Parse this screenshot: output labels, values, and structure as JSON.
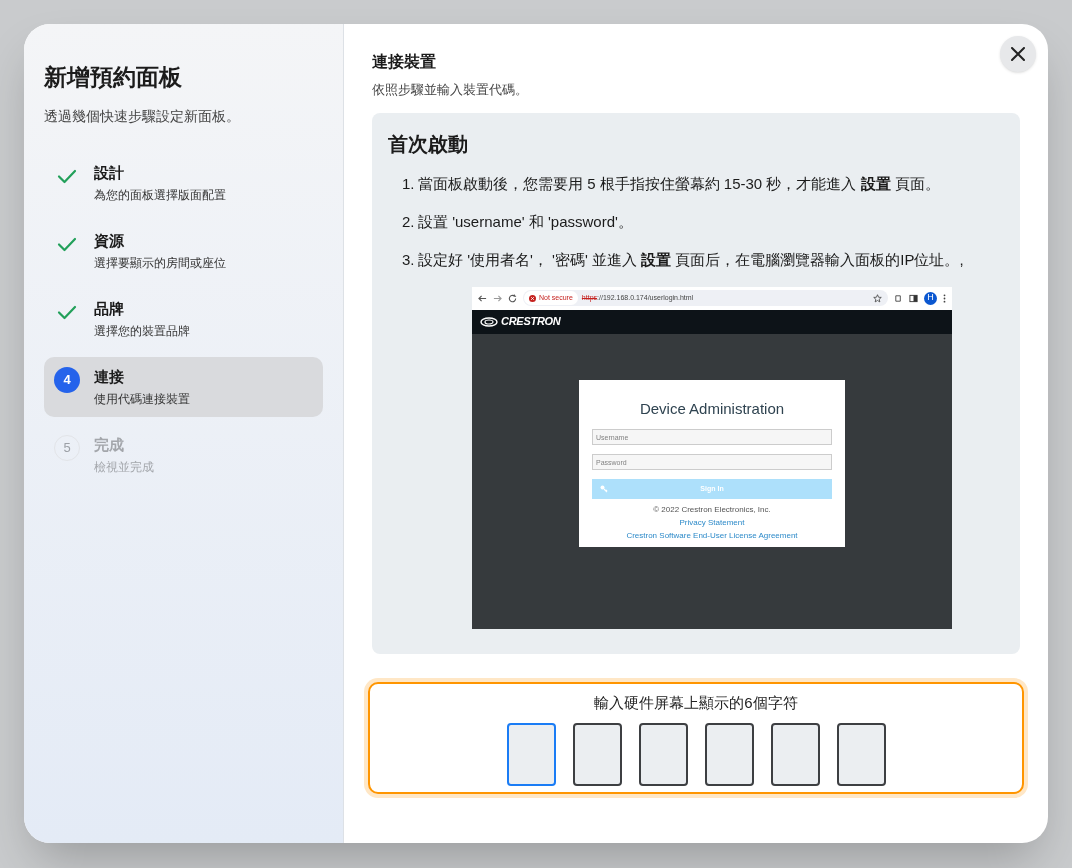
{
  "dialog": {
    "title": "新增預約面板",
    "subtitle": "透過幾個快速步驟設定新面板。"
  },
  "steps": [
    {
      "label": "設計",
      "description": "為您的面板選擇版面配置",
      "completed": true,
      "selected": false
    },
    {
      "label": "資源",
      "description": "選擇要顯示的房間或座位",
      "completed": true,
      "selected": false
    },
    {
      "label": "品牌",
      "description": "選擇您的裝置品牌",
      "completed": true,
      "selected": false
    },
    {
      "number": "4",
      "label": "連接",
      "description": "使用代碼連接裝置",
      "completed": false,
      "selected": true
    },
    {
      "number": "5",
      "label": "完成",
      "description": "檢視並完成",
      "completed": false,
      "selected": false
    }
  ],
  "content": {
    "title": "連接裝置",
    "subtitle": "依照步驟並輸入裝置代碼。"
  },
  "guide": {
    "heading": "首次啟動",
    "steps": [
      {
        "number": "1.",
        "text": "當面板啟動後，您需要用 5 根手指按住螢幕約 15-30 秒，才能進入 **設置** 頁面。"
      },
      {
        "number": "2.",
        "text": "設置 'username' 和 'password'。"
      },
      {
        "number": "3.",
        "text": "設定好 '使用者名'， '密碼' 並進入 **設置** 頁面后，在電腦瀏覽器輸入面板的IP位址。,"
      }
    ],
    "screenshot": {
      "browser": {
        "security": "Not secure",
        "url_scheme": "https",
        "url_rest": "://192.168.0.174/userlogin.html",
        "profile": "H"
      },
      "brand": "CRESTRON",
      "login_title": "Device Administration",
      "username_placeholder": "Username",
      "password_placeholder": "Password",
      "sign_in": "Sign In",
      "copyright": "© 2022 Crestron Electronics, Inc.",
      "links": [
        "Privacy Statement",
        "Crestron Software End-User License Agreement"
      ]
    }
  },
  "code_entry": {
    "label": "輸入硬件屏幕上顯示的6個字符",
    "boxes": [
      {
        "selected": true
      },
      {
        "selected": false
      },
      {
        "selected": false
      },
      {
        "selected": false
      },
      {
        "selected": false
      },
      {
        "selected": false
      }
    ]
  }
}
